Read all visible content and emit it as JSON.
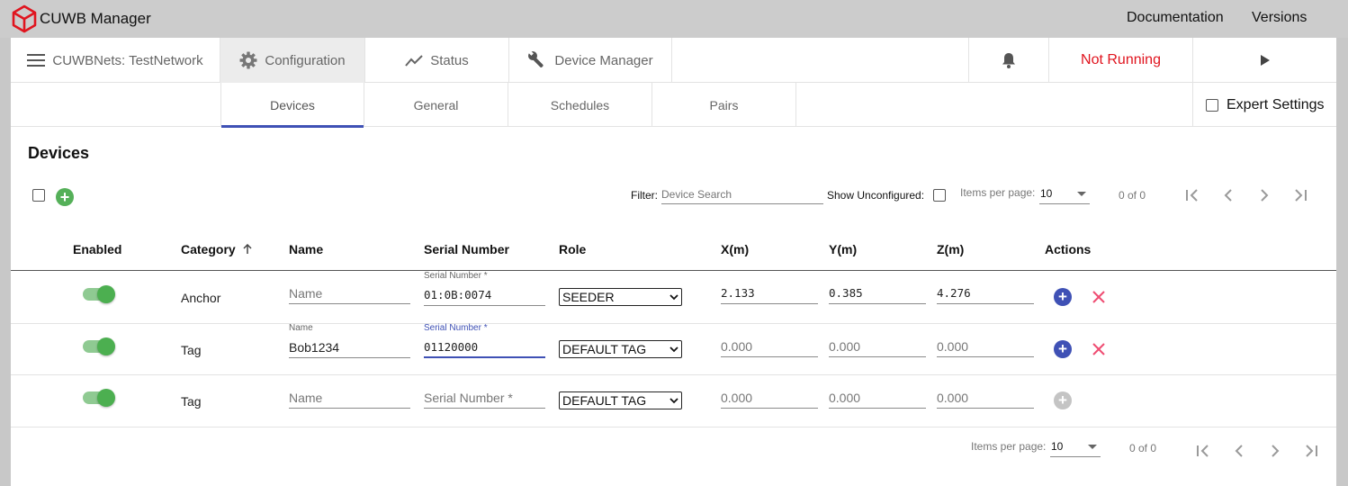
{
  "app": {
    "title": "CUWB Manager"
  },
  "top_links": {
    "documentation": "Documentation",
    "versions": "Versions"
  },
  "nav": {
    "network": "CUWBNets: TestNetwork",
    "configuration": "Configuration",
    "status": "Status",
    "device_manager": "Device Manager",
    "run_state": "Not Running"
  },
  "subtabs": [
    "Devices",
    "General",
    "Schedules",
    "Pairs"
  ],
  "expert_settings": "Expert Settings",
  "section_title": "Devices",
  "toolbar": {
    "filter_label": "Filter:",
    "search_placeholder": "Device Search",
    "show_unconfigured": "Show Unconfigured:",
    "items_per_page_label": "Items per page:",
    "items_per_page": "10",
    "range": "0 of 0"
  },
  "columns": [
    "Enabled",
    "Category",
    "Name",
    "Serial Number",
    "Role",
    "X(m)",
    "Y(m)",
    "Z(m)",
    "Actions"
  ],
  "rows": [
    {
      "category": "Anchor",
      "name_placeholder": "Name",
      "serial_label": "Serial Number *",
      "serial": "01:0B:0074",
      "role": "SEEDER",
      "x": "2.133",
      "y": "0.385",
      "z": "4.276"
    },
    {
      "category": "Tag",
      "name_label": "Name",
      "name": "Bob1234",
      "serial_label": "Serial Number *",
      "serial": "01120000",
      "role": "DEFAULT TAG",
      "x": "0.000",
      "y": "0.000",
      "z": "0.000"
    },
    {
      "category": "Tag",
      "name_placeholder": "Name",
      "serial_placeholder": "Serial Number *",
      "role": "DEFAULT TAG",
      "x": "0.000",
      "y": "0.000",
      "z": "0.000"
    }
  ],
  "footer": {
    "items_per_page_label": "Items per page:",
    "items_per_page": "10",
    "range": "0 of 0"
  },
  "colors": {
    "accent": "#3f51b5",
    "toggle_on": "#4caf50",
    "danger": "#e0141e",
    "add_green": "#55b059"
  }
}
